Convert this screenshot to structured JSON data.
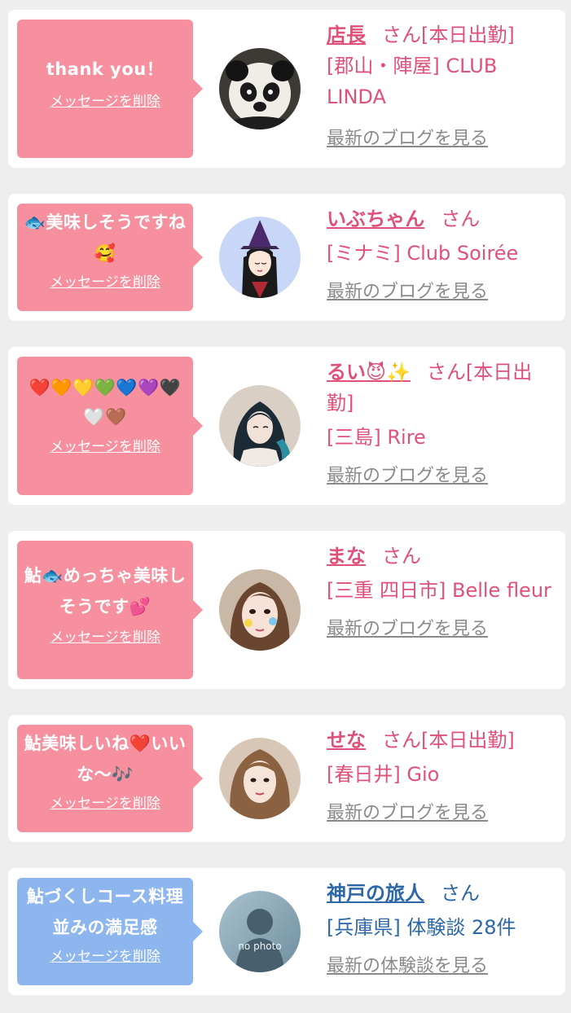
{
  "colors": {
    "background": "#eeeeee",
    "card": "#ffffff",
    "bubble_pink": "#f6909f",
    "bubble_blue": "#8db6ef",
    "name_pink": "#e0517a",
    "name_blue": "#2c68a8",
    "link_gray": "#8a8a8a"
  },
  "items": [
    {
      "message": "thank you！",
      "delete_label": "メッセージを削除",
      "avatar": "panda-avatar",
      "name": "店長",
      "honorific": "さん",
      "status": "[本日出勤]",
      "shop": "[郡山・陣屋] CLUB LINDA",
      "link": "最新のブログを見る",
      "theme": "pink"
    },
    {
      "message": "🐟美味しそうですね🥰",
      "delete_label": "メッセージを削除",
      "avatar": "witch-illustration-avatar",
      "name": "いぶちゃん",
      "honorific": "さん",
      "status": "",
      "shop": "[ミナミ] Club Soirée",
      "link": "最新のブログを見る",
      "theme": "pink"
    },
    {
      "message": "❤️🧡💛💚💙💜🖤🤍🤎",
      "delete_label": "メッセージを削除",
      "avatar": "woman-blue-hair-avatar",
      "name": "るい😈✨",
      "honorific": "さん",
      "status": "[本日出勤]",
      "shop": "[三島] Rire",
      "link": "最新のブログを見る",
      "theme": "pink"
    },
    {
      "message": "鮎🐟めっちゃ美味しそうです💕",
      "delete_label": "メッセージを削除",
      "avatar": "woman-stickers-avatar",
      "name": "まな",
      "honorific": "さん",
      "status": "",
      "shop": "[三重 四日市] Belle fleur",
      "link": "最新のブログを見る",
      "theme": "pink"
    },
    {
      "message": "鮎美味しいね❤️いいな〜🎶",
      "delete_label": "メッセージを削除",
      "avatar": "woman-long-hair-avatar",
      "name": "せな",
      "honorific": "さん",
      "status": "[本日出勤]",
      "shop": "[春日井] Gio",
      "link": "最新のブログを見る",
      "theme": "pink"
    },
    {
      "message": "鮎づくしコース料理並みの満足感",
      "delete_label": "メッセージを削除",
      "avatar": "no-photo-avatar",
      "avatar_text": "no photo",
      "name": "神戸の旅人",
      "honorific": "さん",
      "status": "",
      "shop": "[兵庫県] 体験談 28件",
      "link": "最新の体験談を見る",
      "theme": "blue"
    }
  ]
}
